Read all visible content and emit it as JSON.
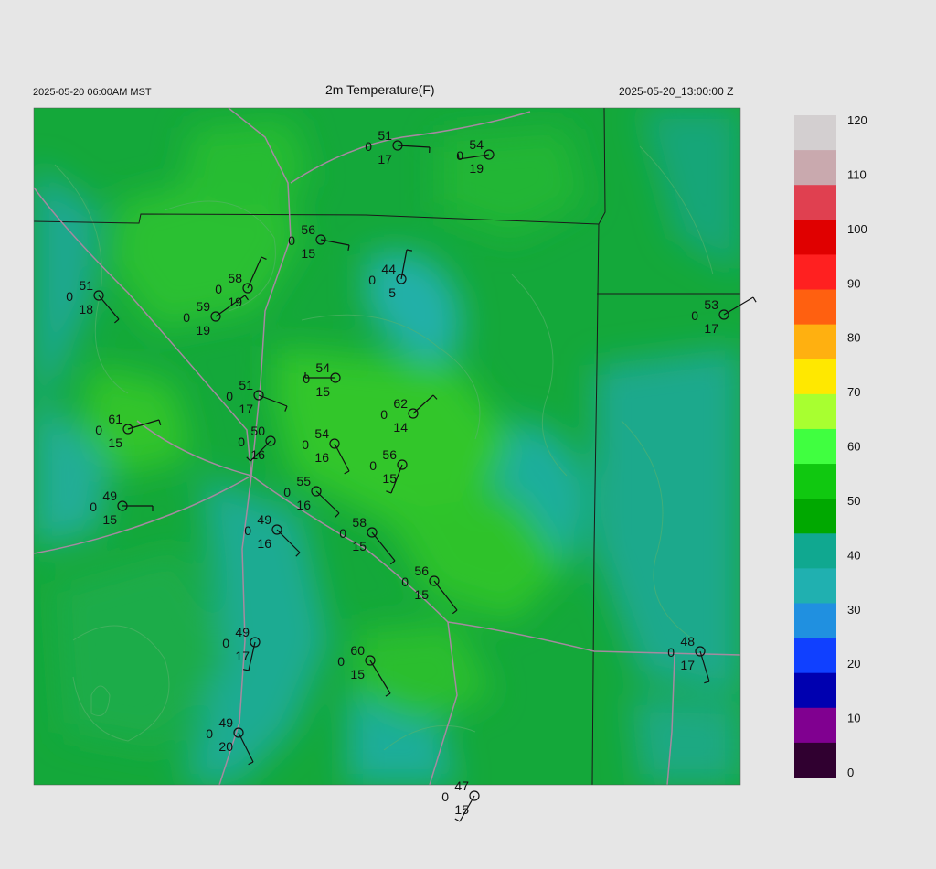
{
  "header": {
    "valid_time_local": "2025-05-20 06:00AM MST",
    "title": "2m Temperature(F)",
    "valid_time_utc": "2025-05-20_13:00:00 Z"
  },
  "colorbar": {
    "labels": [
      "120",
      "110",
      "100",
      "90",
      "80",
      "70",
      "60",
      "50",
      "40",
      "30",
      "20",
      "10",
      "0"
    ],
    "colors": [
      "#d3cfd0",
      "#c9a9ae",
      "#e04050",
      "#e00000",
      "#ff2020",
      "#ff6010",
      "#ffb010",
      "#ffe800",
      "#a8ff30",
      "#40ff40",
      "#10c810",
      "#00a800",
      "#10a890",
      "#20b0b0",
      "#2090e0",
      "#1040ff",
      "#0000b0",
      "#800090",
      "#300030"
    ],
    "colors_note_units": "F"
  },
  "stations": [
    {
      "t": "51",
      "z": "0",
      "d": "17"
    },
    {
      "t": "54",
      "z": "0",
      "d": "19"
    },
    {
      "t": "56",
      "z": "0",
      "d": "15"
    },
    {
      "t": "44",
      "z": "0",
      "d": "5"
    },
    {
      "t": "58",
      "z": "0",
      "d": "19"
    },
    {
      "t": "59",
      "z": "0",
      "d": "19"
    },
    {
      "t": "51",
      "z": "0",
      "d": "18"
    },
    {
      "t": "53",
      "z": "0",
      "d": "17"
    },
    {
      "t": "54",
      "z": "0",
      "d": "15"
    },
    {
      "t": "51",
      "z": "0",
      "d": "17"
    },
    {
      "t": "62",
      "z": "0",
      "d": "14"
    },
    {
      "t": "61",
      "z": "0",
      "d": "15"
    },
    {
      "t": "50",
      "z": "0",
      "d": "16"
    },
    {
      "t": "54",
      "z": "0",
      "d": "16"
    },
    {
      "t": "56",
      "z": "0",
      "d": "15"
    },
    {
      "t": "55",
      "z": "0",
      "d": "16"
    },
    {
      "t": "49",
      "z": "0",
      "d": "15"
    },
    {
      "t": "58",
      "z": "0",
      "d": "15"
    },
    {
      "t": "49",
      "z": "0",
      "d": "16"
    },
    {
      "t": "56",
      "z": "0",
      "d": "15"
    },
    {
      "t": "49",
      "z": "0",
      "d": "17"
    },
    {
      "t": "60",
      "z": "0",
      "d": "15"
    },
    {
      "t": "48",
      "z": "0",
      "d": "17"
    },
    {
      "t": "49",
      "z": "0",
      "d": "20"
    },
    {
      "t": "47",
      "z": "0",
      "d": "15"
    }
  ]
}
